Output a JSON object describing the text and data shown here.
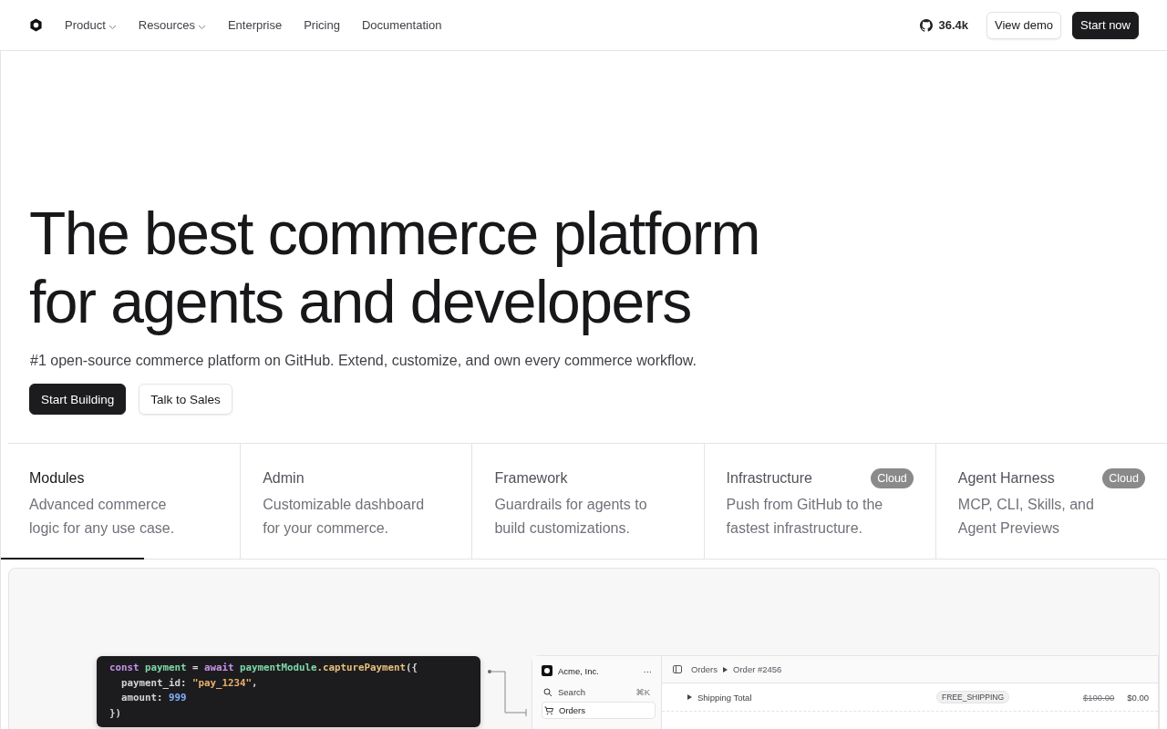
{
  "nav": {
    "links": [
      {
        "label": "Product",
        "dropdown": true
      },
      {
        "label": "Resources",
        "dropdown": true
      },
      {
        "label": "Enterprise",
        "dropdown": false
      },
      {
        "label": "Pricing",
        "dropdown": false
      },
      {
        "label": "Documentation",
        "dropdown": false
      }
    ],
    "stars": "36.4k",
    "buttons": [
      {
        "label": "View demo",
        "kind": "secondary"
      },
      {
        "label": "Start now",
        "kind": "primary"
      }
    ]
  },
  "hero": {
    "title_lines": [
      "The best commerce platform",
      "for agents and developers"
    ],
    "subtitle": "#1 open-source commerce platform on GitHub. Extend, customize, and own every commerce workflow.",
    "buttons": [
      {
        "label": "Start Building",
        "kind": "primary"
      },
      {
        "label": "Talk to Sales",
        "kind": "secondary"
      }
    ]
  },
  "tabs": [
    {
      "title": "Modules",
      "description": "Advanced commerce logic for any use case.",
      "selected": true
    },
    {
      "title": "Admin",
      "description": "Customizable dashboard for your commerce.",
      "selected": false
    },
    {
      "title": "Framework",
      "description": "Guardrails for agents to build customizations.",
      "selected": false
    },
    {
      "title": "Infrastructure",
      "badge": "Cloud",
      "description": "Push from GitHub to the fastest infrastructure.",
      "selected": false
    },
    {
      "title": "Agent Harness",
      "badge": "Cloud",
      "description": "MCP, CLI, Skills, and Agent Previews",
      "selected": false
    }
  ],
  "demo": {
    "code": [
      [
        {
          "text": "const ",
          "color": "#c792ea"
        },
        {
          "text": "payment ",
          "color": "#7fd8a8"
        },
        {
          "text": "= "
        },
        {
          "text": "await ",
          "color": "#c792ea"
        },
        {
          "text": "paymentModule",
          "color": "#7fd8a8"
        },
        {
          "text": ".capturePayment",
          "color": "#e8c07d"
        },
        {
          "text": "({"
        }
      ],
      [
        {
          "text": "  payment_id: "
        },
        {
          "text": "\"pay_1234\"",
          "color": "#e8b06d"
        },
        {
          "text": ","
        }
      ],
      [
        {
          "text": "  amount: "
        },
        {
          "text": "999",
          "color": "#7fb0ff"
        }
      ],
      [
        {
          "text": "})"
        }
      ]
    ],
    "admin": {
      "store": "Acme, Inc.",
      "more": "···",
      "search": {
        "label": "Search",
        "shortcut": "⌘K"
      },
      "nav_items": [
        {
          "label": "Orders",
          "selected": true
        }
      ],
      "breadcrumb": [
        "Orders",
        "Order #2456"
      ],
      "rows": [
        {
          "label": "Shipping Total",
          "tag": "FREE_SHIPPING",
          "old_price": "$100.00",
          "price": "$0.00"
        }
      ]
    }
  }
}
